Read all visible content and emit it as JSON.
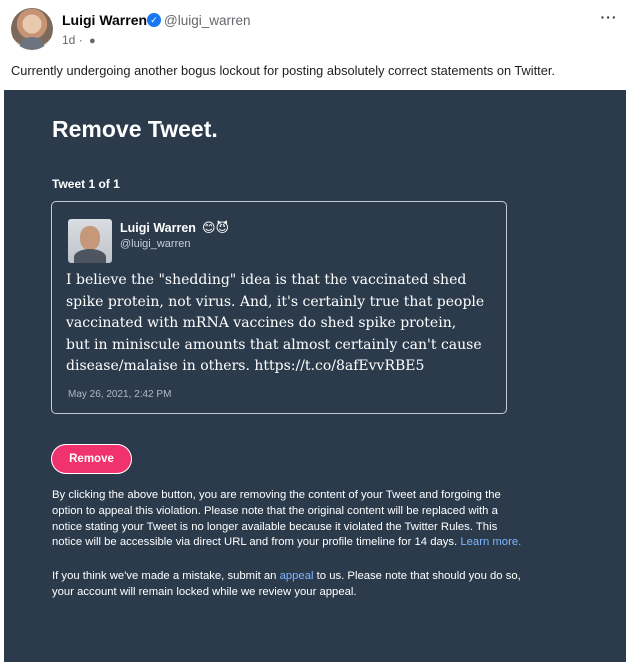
{
  "post": {
    "author": "Luigi Warren",
    "verified_icon": "verified-badge-icon",
    "handle": "@luigi_warren",
    "age": "1d",
    "separator": "·",
    "audience_icon": "public-globe-icon",
    "more_label": "···",
    "caption": "Currently undergoing another bogus lockout for posting absolutely correct statements on Twitter."
  },
  "notice": {
    "title": "Remove Tweet.",
    "tweet_count": "Tweet 1 of 1",
    "tweet": {
      "author": "Luigi Warren",
      "emoji": "😊😈",
      "handle": "@luigi_warren",
      "lines": [
        "I believe the \"shedding\" idea is that the vaccinated shed",
        "spike protein, not virus. And, it's certainly true that people",
        "vaccinated with mRNA vaccines do shed spike protein,",
        "but in miniscule amounts that almost certainly can't cause",
        "disease/malaise in others. https://t.co/8afEvvRBE5"
      ],
      "date": "May 26, 2021, 2:42 PM"
    },
    "remove_label": "Remove",
    "paragraph1": {
      "lines": [
        "By clicking the above button, you are removing the content of your Tweet and forgoing the",
        "option to appeal this violation. Please note that the original content will be replaced with a",
        "notice stating your Tweet is no longer available because it violated the Twitter Rules. This"
      ],
      "last_line": "notice will be accessible via direct URL and from your profile timeline for 14 days.",
      "link": "Learn more."
    },
    "paragraph2": {
      "before_link": "If you think we've made a mistake, submit an",
      "link": "appeal",
      "after_link": "to us. Please note that should you do so,",
      "line2": "your account will remain locked while we review your appeal."
    }
  },
  "colors": {
    "notice_background": "#2b3b4c",
    "button": "#f0336f",
    "link": "#7fb6ff",
    "verified": "#1877f2"
  }
}
